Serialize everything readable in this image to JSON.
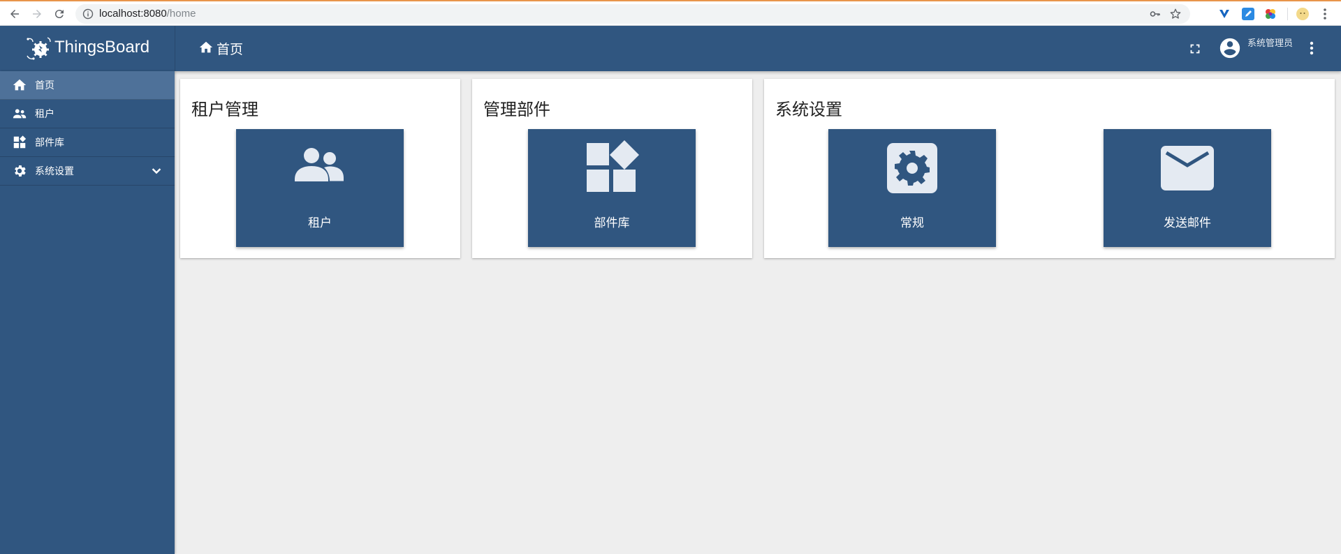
{
  "browser": {
    "url_host": "localhost:8080",
    "url_path": "/home"
  },
  "header": {
    "logo_text": "ThingsBoard",
    "breadcrumb": "首页",
    "user_name": "系统管理员"
  },
  "sidebar": {
    "items": [
      {
        "label": "首页",
        "icon": "home-icon"
      },
      {
        "label": "租户",
        "icon": "people-icon"
      },
      {
        "label": "部件库",
        "icon": "widgets-icon"
      },
      {
        "label": "系统设置",
        "icon": "gear-icon"
      }
    ]
  },
  "cards": [
    {
      "title": "租户管理",
      "tiles": [
        {
          "label": "租户",
          "icon": "people-icon"
        }
      ]
    },
    {
      "title": "管理部件",
      "tiles": [
        {
          "label": "部件库",
          "icon": "widgets-icon"
        }
      ]
    },
    {
      "title": "系统设置",
      "tiles": [
        {
          "label": "常规",
          "icon": "settings-icon"
        },
        {
          "label": "发送邮件",
          "icon": "mail-icon"
        }
      ]
    }
  ],
  "colors": {
    "primary": "#305680",
    "sidebar_active": "#4e7199",
    "background": "#eeeeee",
    "tile_icon": "#e4eaf2"
  }
}
